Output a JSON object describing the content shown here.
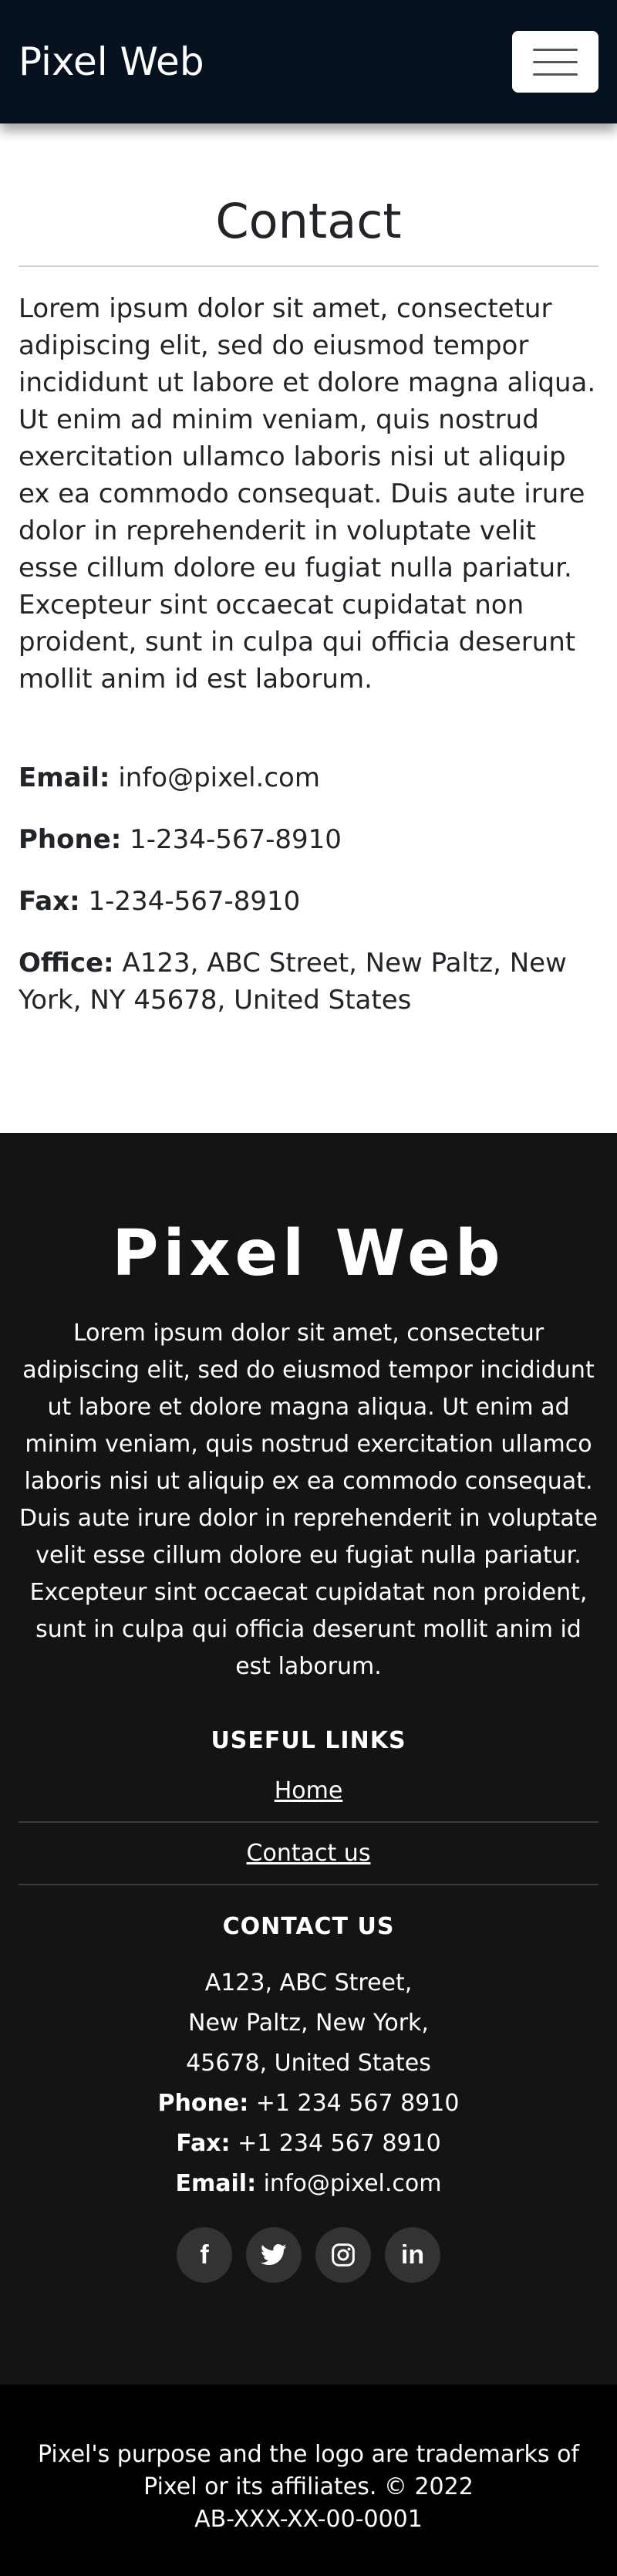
{
  "nav": {
    "brand": "Pixel Web"
  },
  "contact": {
    "title": "Contact",
    "intro": "Lorem ipsum dolor sit amet, consectetur adipiscing elit, sed do eiusmod tempor incididunt ut labore et dolore magna aliqua. Ut enim ad minim veniam, quis nostrud exercitation ullamco laboris nisi ut aliquip ex ea commodo consequat. Duis aute irure dolor in reprehenderit in voluptate velit esse cillum dolore eu fugiat nulla pariatur. Excepteur sint occaecat cupidatat non proident, sunt in culpa qui officia deserunt mollit anim id est laborum.",
    "email_label": "Email:",
    "email_value": " info@pixel.com",
    "phone_label": "Phone:",
    "phone_value": " 1-234-567-8910",
    "fax_label": "Fax:",
    "fax_value": " 1-234-567-8910",
    "office_label": "Office:",
    "office_value": " A123, ABC Street, New Paltz, New York, NY 45678, United States"
  },
  "footer": {
    "logo": "Pixel Web",
    "about": "Lorem ipsum dolor sit amet, consectetur adipiscing elit, sed do eiusmod tempor incididunt ut labore et dolore magna aliqua. Ut enim ad minim veniam, quis nostrud exercitation ullamco laboris nisi ut aliquip ex ea commodo consequat. Duis aute irure dolor in reprehenderit in voluptate velit esse cillum dolore eu fugiat nulla pariatur. Excepteur sint occaecat cupidatat non proident, sunt in culpa qui officia deserunt mollit anim id est laborum.",
    "links_heading": "USEFUL LINKS",
    "links": [
      "Home",
      "Contact us"
    ],
    "contact_heading": "CONTACT US",
    "address_line1": "A123, ABC Street,",
    "address_line2": "New Paltz, New York,",
    "address_line3": "45678, United States",
    "phone_label": "Phone:",
    "phone_value": " +1 234 567 8910",
    "fax_label": "Fax:",
    "fax_value": " +1 234 567 8910",
    "email_label": "Email:",
    "email_value": " info@pixel.com",
    "socials": [
      {
        "icon": "facebook-icon",
        "glyph": "f"
      },
      {
        "icon": "twitter-icon",
        "glyph": "🐦"
      },
      {
        "icon": "instagram-icon",
        "glyph": "◎"
      },
      {
        "icon": "linkedin-icon",
        "glyph": "in"
      }
    ]
  },
  "bottom": {
    "text": "Pixel's purpose and the logo are trademarks of Pixel or its affiliates. © 2022",
    "code": "AB-XXX-XX-00-0001"
  },
  "colors": {
    "navbar": "#06121f",
    "footer": "#141414",
    "bottom_bar": "#000000",
    "social_bg": "#333333"
  }
}
